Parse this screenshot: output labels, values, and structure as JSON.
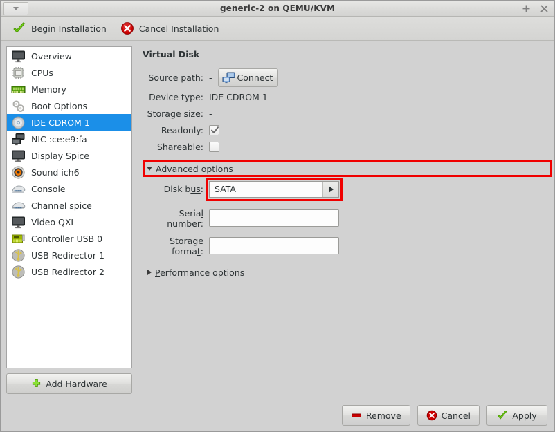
{
  "window": {
    "title": "generic-2 on QEMU/KVM",
    "menu_icon": "chevron-down-icon",
    "maximize_label": "+",
    "close_label": "×"
  },
  "toolbar": {
    "items": [
      {
        "label": "Begin Installation",
        "icon": "green-check-icon"
      },
      {
        "label": "Cancel Installation",
        "icon": "red-x-circle-icon"
      }
    ]
  },
  "sidebar": {
    "items": [
      {
        "label": "Overview",
        "icon": "monitor-icon",
        "selected": false
      },
      {
        "label": "CPUs",
        "icon": "cpu-chip-icon",
        "selected": false
      },
      {
        "label": "Memory",
        "icon": "memory-ram-icon",
        "selected": false
      },
      {
        "label": "Boot Options",
        "icon": "gears-icon",
        "selected": false
      },
      {
        "label": "IDE CDROM 1",
        "icon": "cdrom-disc-icon",
        "selected": true
      },
      {
        "label": "NIC :ce:e9:fa",
        "icon": "network-card-icon",
        "selected": false
      },
      {
        "label": "Display Spice",
        "icon": "monitor-icon",
        "selected": false
      },
      {
        "label": "Sound ich6",
        "icon": "speaker-icon",
        "selected": false
      },
      {
        "label": "Console",
        "icon": "console-icon",
        "selected": false
      },
      {
        "label": "Channel spice",
        "icon": "console-icon",
        "selected": false
      },
      {
        "label": "Video QXL",
        "icon": "monitor-icon",
        "selected": false
      },
      {
        "label": "Controller USB 0",
        "icon": "pci-card-icon",
        "selected": false
      },
      {
        "label": "USB Redirector 1",
        "icon": "usb-icon",
        "selected": false
      },
      {
        "label": "USB Redirector 2",
        "icon": "usb-icon",
        "selected": false
      }
    ],
    "add_hardware_label": "Add Hardware",
    "add_hardware_icon": "green-plus-icon"
  },
  "main": {
    "title": "Virtual Disk",
    "source_path_label": "Source path:",
    "source_path_value": "-",
    "connect_label": "Connect",
    "connect_icon": "network-connect-icon",
    "device_type_label": "Device type:",
    "device_type_value": "IDE CDROM 1",
    "storage_size_label": "Storage size:",
    "storage_size_value": "-",
    "readonly_label": "Readonly:",
    "readonly_checked": true,
    "shareable_label": "Shareable:",
    "shareable_checked": false,
    "advanced_options_label": "Advanced options",
    "advanced_expanded": true,
    "disk_bus_label": "Disk bus:",
    "disk_bus_value": "SATA",
    "disk_bus_options": [
      "SATA"
    ],
    "serial_number_label": "Serial number:",
    "serial_number_value": "",
    "storage_format_label": "Storage format:",
    "storage_format_value": "",
    "performance_options_label": "Performance options",
    "performance_expanded": false
  },
  "footer": {
    "buttons": [
      {
        "label": "Remove",
        "icon": "red-minus-icon"
      },
      {
        "label": "Cancel",
        "icon": "red-x-circle-icon"
      },
      {
        "label": "Apply",
        "icon": "green-check-icon"
      }
    ]
  },
  "highlights": {
    "color": "#f00000",
    "targets": [
      "advanced-options-toggle",
      "disk-bus-combobox"
    ]
  }
}
